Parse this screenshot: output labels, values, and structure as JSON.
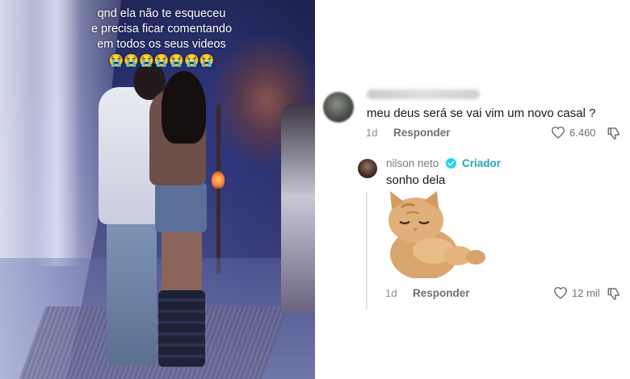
{
  "video": {
    "caption_lines": [
      "qnd ela não te esqueceu",
      "e precisa ficar comentando",
      "em todos os seus videos"
    ],
    "caption_emojis": "😭😭😭😭😭😭😭"
  },
  "comments": [
    {
      "text": "meu deus será se vai vim um novo casal ?",
      "age": "1d",
      "reply_label": "Responder",
      "likes": "6.460"
    }
  ],
  "reply": {
    "username": "nilson neto",
    "creator_label": "Criador",
    "text": "sonho dela",
    "age": "1d",
    "reply_label": "Responder",
    "likes": "12 mil"
  },
  "icons": {
    "like": "heart-outline-icon",
    "dislike": "thumbs-down-icon",
    "verified": "verified-badge-icon"
  },
  "colors": {
    "text_primary": "#161823",
    "text_secondary": "#8a8b91",
    "creator_label": "#22a7b8",
    "verified_badge": "#20d5ec"
  }
}
